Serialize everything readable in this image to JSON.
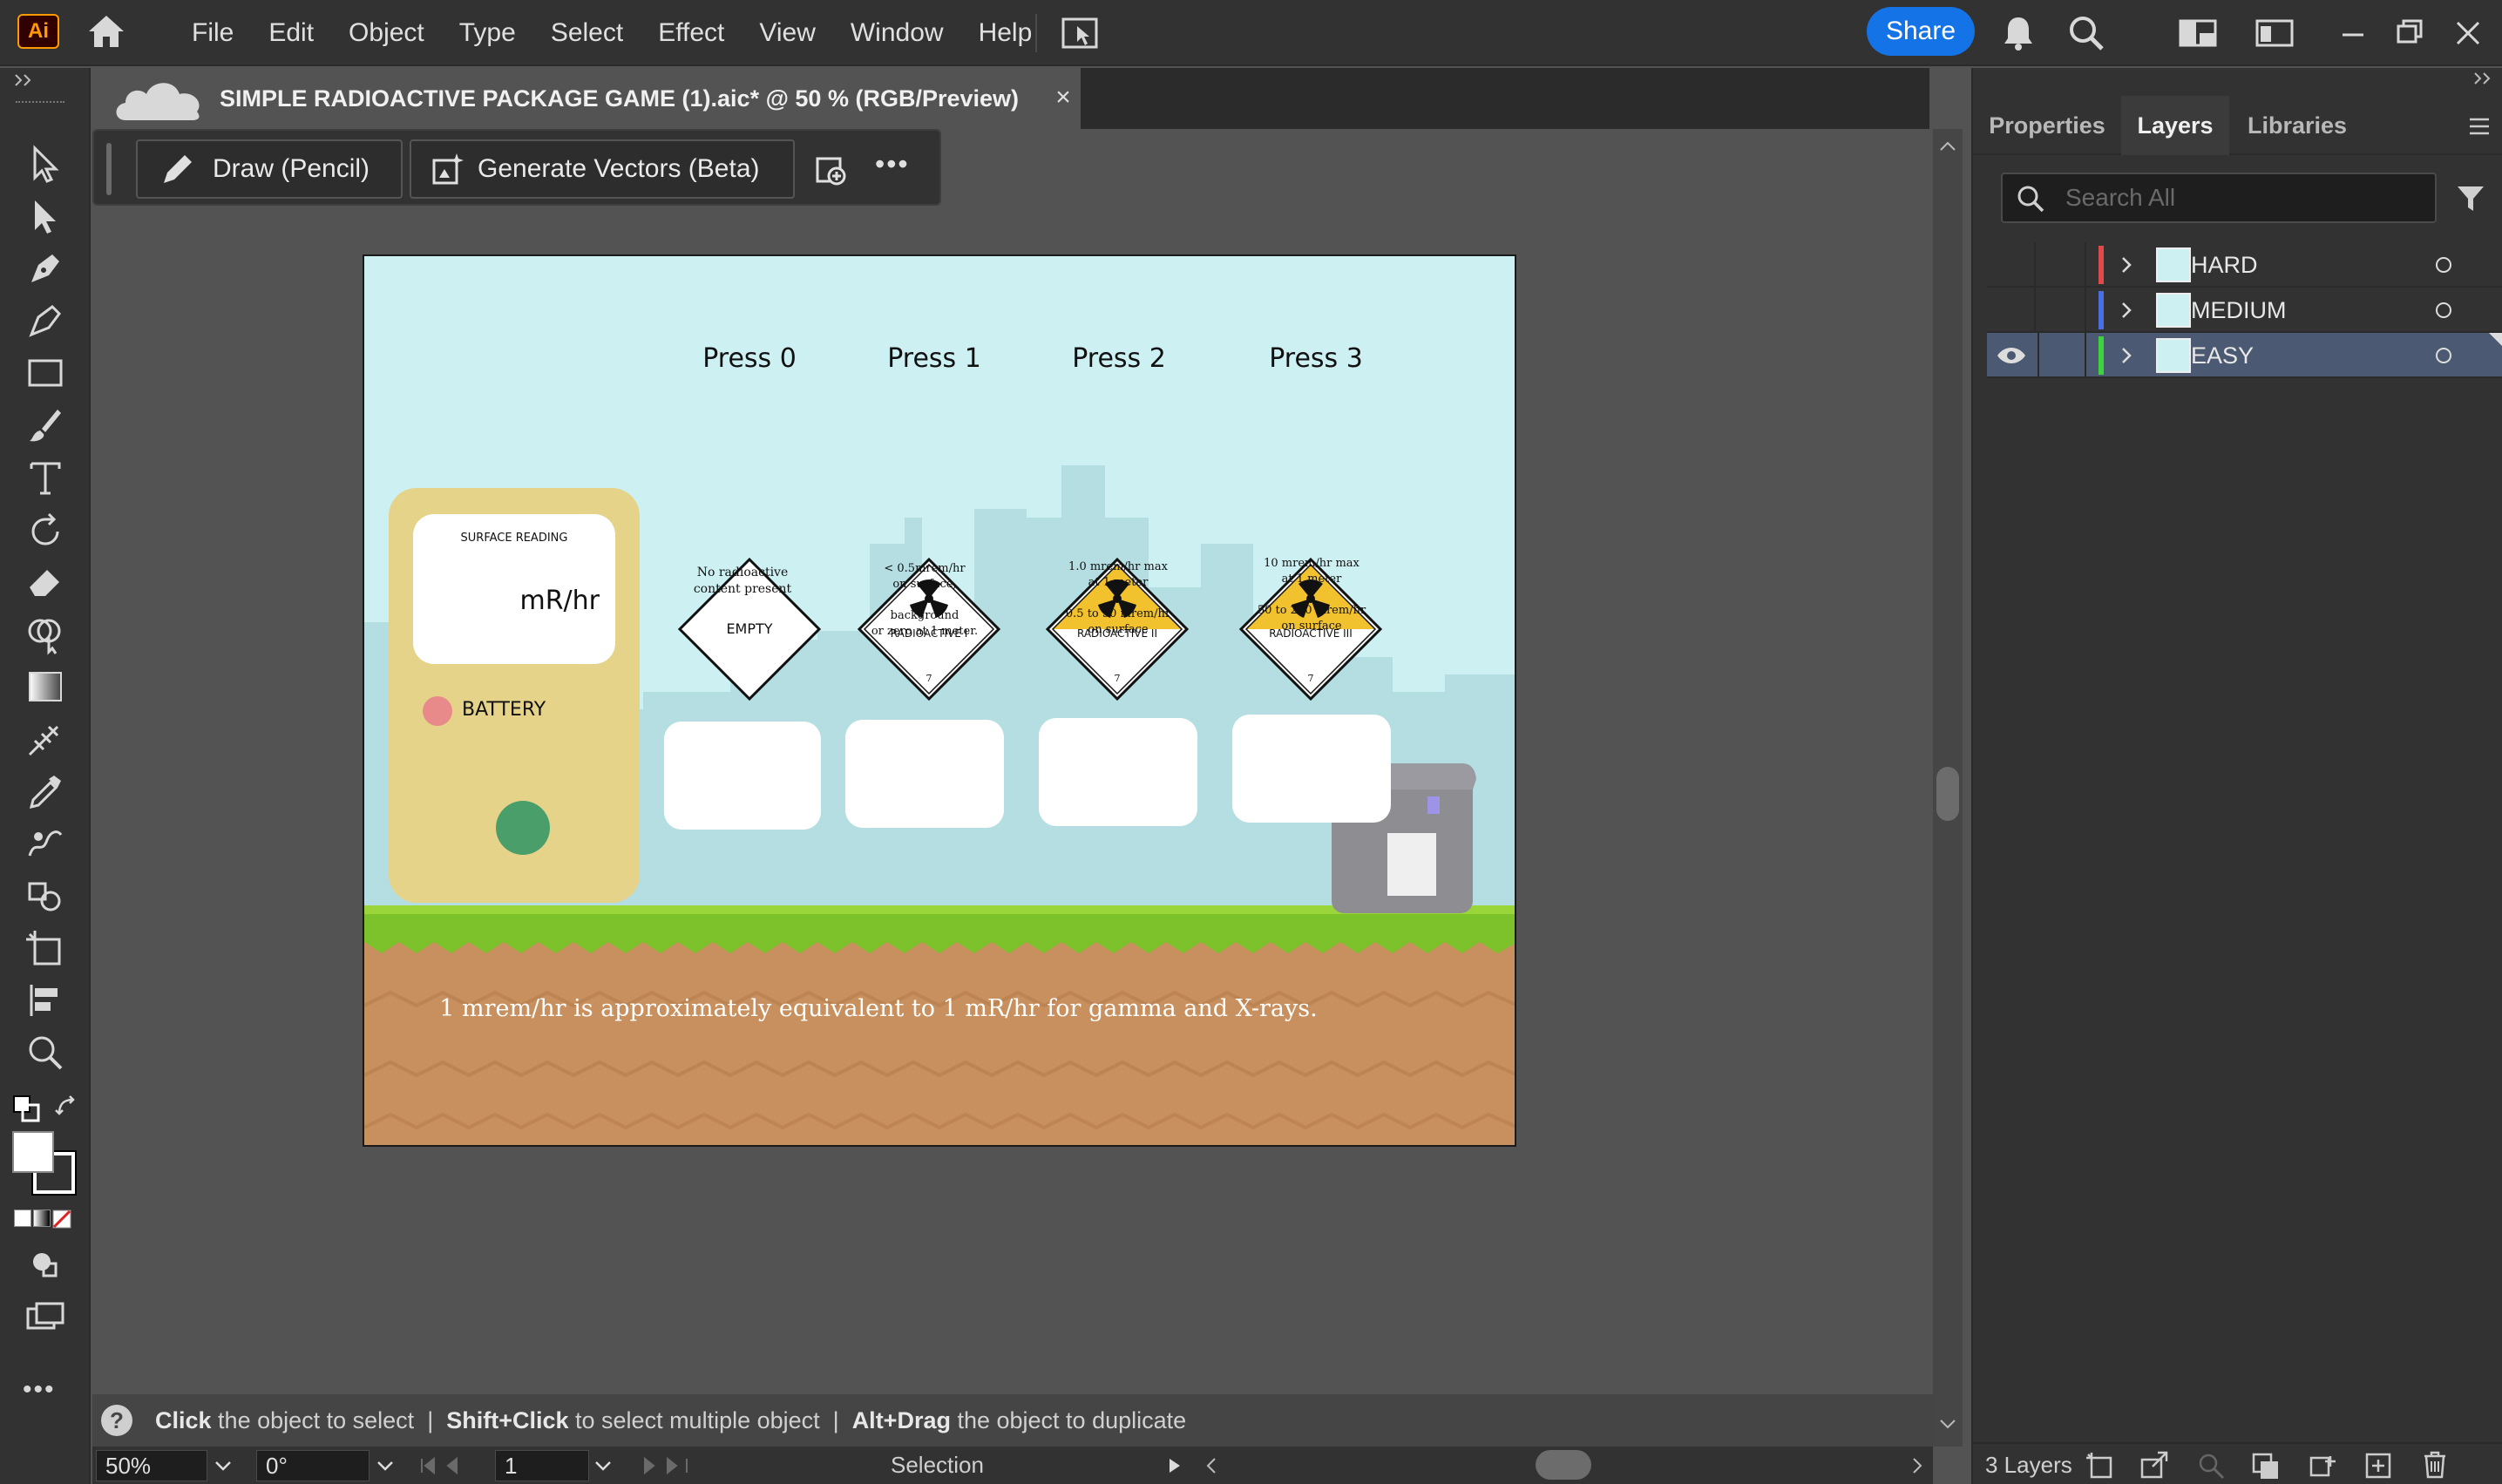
{
  "app": {
    "logo": "Ai"
  },
  "menu": [
    "File",
    "Edit",
    "Object",
    "Type",
    "Select",
    "Effect",
    "View",
    "Window",
    "Help"
  ],
  "share_label": "Share",
  "document": {
    "tab_title": "SIMPLE RADIOACTIVE PACKAGE GAME (1).aic* @ 50 % (RGB/Preview)",
    "close": "×"
  },
  "context_bar": {
    "draw_label": "Draw (Pencil)",
    "generate_label": "Generate Vectors (Beta)",
    "more": "•••"
  },
  "artboard": {
    "presses": [
      {
        "label": "Press 0",
        "diamond": "EMPTY",
        "class_num": "",
        "desc": [
          "No radioactive",
          "content present"
        ]
      },
      {
        "label": "Press 1",
        "diamond": "RADIOACTIVE I",
        "class_num": "7",
        "desc": [
          "< 0.5mrem/hr",
          "on surface,",
          "",
          "background",
          "or zero at 1 meter."
        ]
      },
      {
        "label": "Press 2",
        "diamond": "RADIOACTIVE II",
        "class_num": "7",
        "desc": [
          "1.0 mrem/hr max",
          "at 1 meter",
          "",
          "0.5 to 50 mrem/hr",
          "on surface"
        ]
      },
      {
        "label": "Press 3",
        "diamond": "RADIOACTIVE III",
        "class_num": "7",
        "desc": [
          "10 mrem/hr max",
          "at 1 meter",
          "",
          "50 to 200  mrem/hr",
          "on surface"
        ]
      }
    ],
    "meter": {
      "reading_label": "SURFACE READING",
      "unit": "mR/hr",
      "battery_label": "BATTERY"
    },
    "footer_note": "1 mrem/hr is approximately equivalent to 1 mR/hr for gamma and X-rays.",
    "colors": {
      "sky": "#cdf0f2",
      "grass": "#7dc22a",
      "dirt": "#c8905e",
      "meter": "#e6d38a",
      "yellow": "#f2c12e"
    }
  },
  "hint": {
    "q": "?",
    "parts": [
      {
        "bold": "Click",
        "text": " the object to select  |  "
      },
      {
        "bold": "Shift+Click",
        "text": " to select multiple object  |  "
      },
      {
        "bold": "Alt+Drag",
        "text": " the object to duplicate"
      }
    ]
  },
  "statusbar": {
    "zoom": "50%",
    "rotation": "0°",
    "artboard_num": "1",
    "mode": "Selection"
  },
  "panel": {
    "tabs": [
      "Properties",
      "Layers",
      "Libraries"
    ],
    "active_tab": "Layers",
    "search_placeholder": "Search All",
    "layers": [
      {
        "name": "HARD",
        "color": "#e04a4a",
        "visible": false,
        "active": false
      },
      {
        "name": "MEDIUM",
        "color": "#4a6fe0",
        "visible": false,
        "active": false
      },
      {
        "name": "EASY",
        "color": "#3fd23f",
        "visible": true,
        "active": true
      }
    ],
    "footer_count": "3 Layers"
  }
}
